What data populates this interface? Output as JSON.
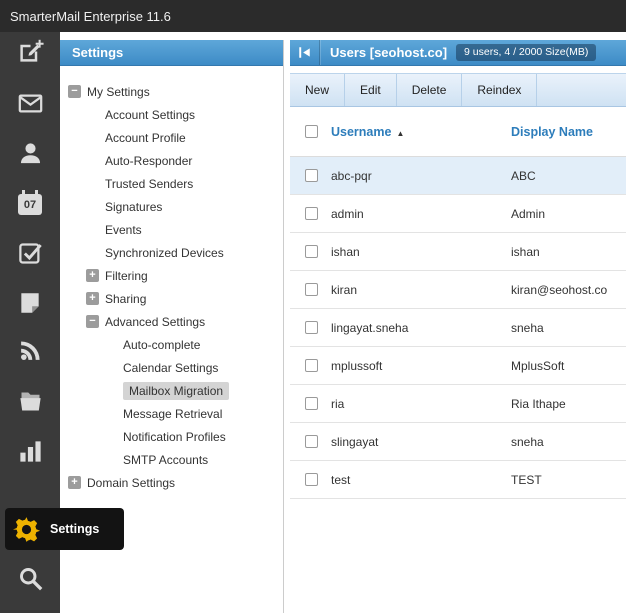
{
  "app": {
    "title": "SmarterMail Enterprise 11.6"
  },
  "rail": {
    "icons": [
      "compose",
      "mail",
      "contacts",
      "calendar",
      "tasks",
      "notes",
      "rss",
      "folders",
      "reports",
      "settings",
      "search"
    ],
    "active": "settings",
    "calendar_label": "07",
    "tooltip": "Settings"
  },
  "settings_panel": {
    "title": "Settings",
    "tree": [
      {
        "label": "My Settings",
        "level": 0,
        "expand_state": "expanded"
      },
      {
        "label": "Account Settings",
        "level": 1
      },
      {
        "label": "Account Profile",
        "level": 1
      },
      {
        "label": "Auto-Responder",
        "level": 1
      },
      {
        "label": "Trusted Senders",
        "level": 1
      },
      {
        "label": "Signatures",
        "level": 1
      },
      {
        "label": "Events",
        "level": 1
      },
      {
        "label": "Synchronized Devices",
        "level": 1
      },
      {
        "label": "Filtering",
        "level": 1,
        "expand_state": "collapsed"
      },
      {
        "label": "Sharing",
        "level": 1,
        "expand_state": "collapsed"
      },
      {
        "label": "Advanced Settings",
        "level": 1,
        "expand_state": "expanded"
      },
      {
        "label": "Auto-complete",
        "level": 2
      },
      {
        "label": "Calendar Settings",
        "level": 2
      },
      {
        "label": "Mailbox Migration",
        "level": 2,
        "selected": true
      },
      {
        "label": "Message Retrieval",
        "level": 2
      },
      {
        "label": "Notification Profiles",
        "level": 2
      },
      {
        "label": "SMTP Accounts",
        "level": 2
      },
      {
        "label": "Domain Settings",
        "level": 0,
        "expand_state": "collapsed"
      }
    ]
  },
  "content": {
    "header": {
      "title": "Users [seohost.co]",
      "badge": "9 users, 4 / 2000 Size(MB)"
    },
    "toolbar": [
      "New",
      "Edit",
      "Delete",
      "Reindex"
    ],
    "table": {
      "columns": [
        "Username",
        "Display Name"
      ],
      "sort": {
        "column": "Username",
        "direction": "asc"
      },
      "rows": [
        {
          "username": "abc-pqr",
          "display_name": "ABC",
          "selected": true
        },
        {
          "username": "admin",
          "display_name": "Admin"
        },
        {
          "username": "ishan",
          "display_name": "ishan"
        },
        {
          "username": "kiran",
          "display_name": "kiran@seohost.co"
        },
        {
          "username": "lingayat.sneha",
          "display_name": "sneha"
        },
        {
          "username": "mplussoft",
          "display_name": "MplusSoft"
        },
        {
          "username": "ria",
          "display_name": "Ria Ithape"
        },
        {
          "username": "slingayat",
          "display_name": "sneha"
        },
        {
          "username": "test",
          "display_name": "TEST"
        }
      ]
    }
  }
}
